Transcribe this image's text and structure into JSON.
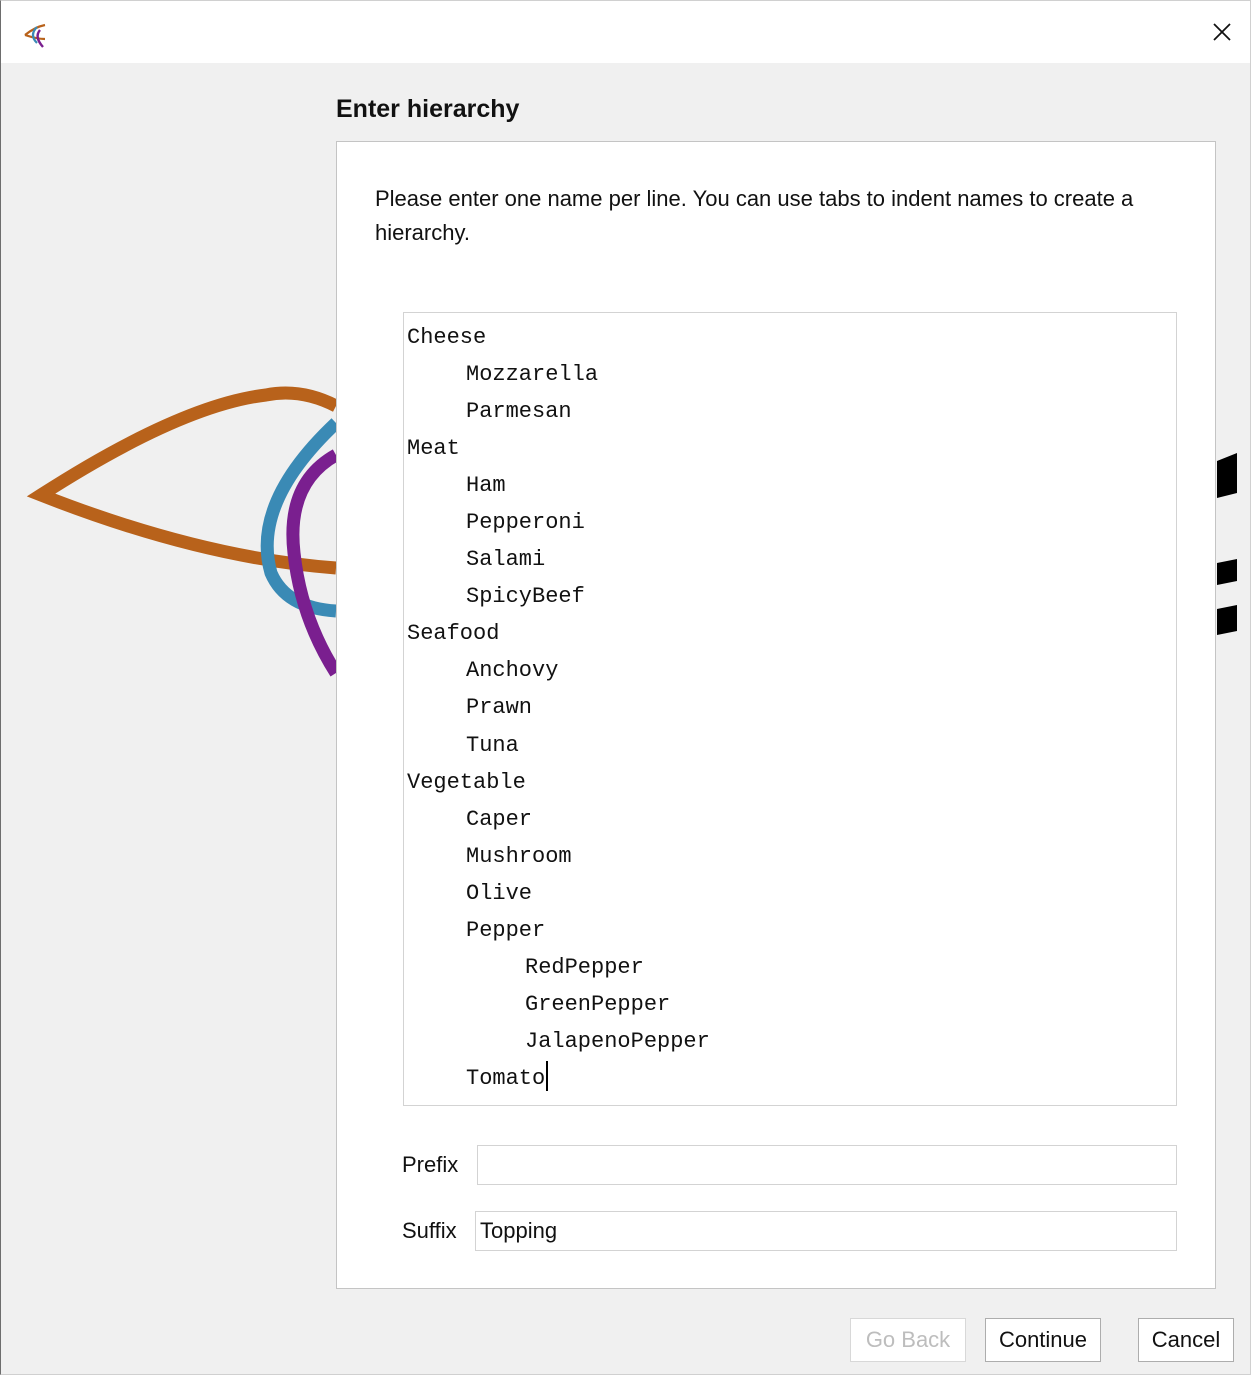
{
  "titlebar": {
    "icon": "app-logo-icon",
    "close_icon": "close-icon"
  },
  "heading": "Enter hierarchy",
  "instructions": "Please enter one name per line. You can use tabs to indent names to create a hierarchy.",
  "hierarchy_lines": [
    {
      "indent": 0,
      "text": "Cheese"
    },
    {
      "indent": 1,
      "text": "Mozzarella"
    },
    {
      "indent": 1,
      "text": "Parmesan"
    },
    {
      "indent": 0,
      "text": "Meat"
    },
    {
      "indent": 1,
      "text": "Ham"
    },
    {
      "indent": 1,
      "text": "Pepperoni"
    },
    {
      "indent": 1,
      "text": "Salami"
    },
    {
      "indent": 1,
      "text": "SpicyBeef"
    },
    {
      "indent": 0,
      "text": "Seafood"
    },
    {
      "indent": 1,
      "text": "Anchovy"
    },
    {
      "indent": 1,
      "text": "Prawn"
    },
    {
      "indent": 1,
      "text": "Tuna"
    },
    {
      "indent": 0,
      "text": "Vegetable"
    },
    {
      "indent": 1,
      "text": "Caper"
    },
    {
      "indent": 1,
      "text": "Mushroom"
    },
    {
      "indent": 1,
      "text": "Olive"
    },
    {
      "indent": 1,
      "text": "Pepper"
    },
    {
      "indent": 2,
      "text": "RedPepper"
    },
    {
      "indent": 2,
      "text": "GreenPepper"
    },
    {
      "indent": 2,
      "text": "JalapenoPepper"
    },
    {
      "indent": 1,
      "text": "Tomato"
    }
  ],
  "prefix": {
    "label": "Prefix",
    "value": ""
  },
  "suffix": {
    "label": "Suffix",
    "value": "Topping"
  },
  "buttons": {
    "go_back": "Go Back",
    "continue": "Continue",
    "cancel": "Cancel"
  },
  "colors": {
    "logo_orange": "#b8621b",
    "logo_blue": "#3a8ab5",
    "logo_purple": "#7a1f8f",
    "window_bg": "#f0f0f0",
    "panel_bg": "#ffffff"
  }
}
